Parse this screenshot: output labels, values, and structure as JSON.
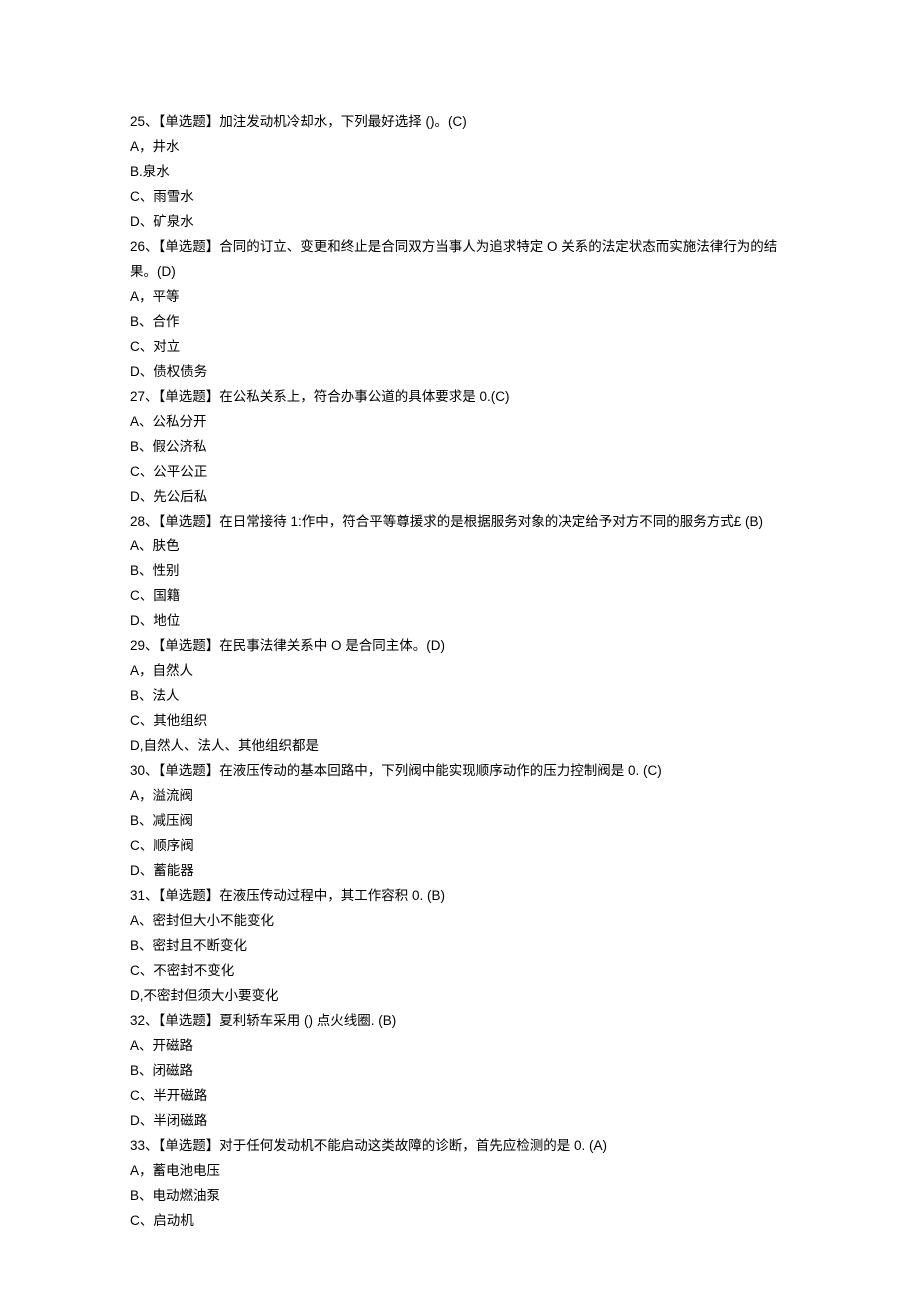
{
  "questions": [
    {
      "stem": "25、【单选题】加注发动机冷却水，下列最好选择 ()。(C)",
      "options": [
        "A，井水",
        "B.泉水",
        "C、雨雪水",
        "D、矿泉水"
      ]
    },
    {
      "stem": "26、【单选题】合同的订立、变更和终止是合同双方当事人为追求特定 O 关系的法定状态而实施法律行为的结果。(D)",
      "options": [
        "A，平等",
        "B、合作",
        "C、对立",
        "D、债权债务"
      ]
    },
    {
      "stem": "27、【单选题】在公私关系上，符合办事公道的具体要求是 0.(C)",
      "options": [
        "A、公私分开",
        "B、假公济私",
        "C、公平公正",
        "D、先公后私"
      ]
    },
    {
      "stem": "28、【单选题】在日常接待 1:作中，符合平等尊援求的是根据服务对象的决定给予对方不同的服务方式£ (B)",
      "options": [
        "A、肤色",
        "B、性别",
        "C、国籍",
        "D、地位"
      ]
    },
    {
      "stem": "29、【单选题】在民事法律关系中 O 是合同主体。(D)",
      "options": [
        "A，自然人",
        "B、法人",
        "C、其他组织",
        "D,自然人、法人、其他组织都是"
      ]
    },
    {
      "stem": "30、【单选题】在液压传动的基本回路中，下列阀中能实现顺序动作的压力控制阀是 0. (C)",
      "options": [
        "A，溢流阀",
        "B、减压阀",
        "C、顺序阀",
        "D、蓄能器"
      ]
    },
    {
      "stem": "31、【单选题】在液压传动过程中，其工作容积 0. (B)",
      "options": [
        "A、密封但大小不能变化",
        "B、密封且不断变化",
        "C、不密封不变化",
        "D,不密封但须大小要变化"
      ]
    },
    {
      "stem": "32、【单选题】夏利轿车采用 () 点火线圈. (B)",
      "options": [
        "A、开磁路",
        "B、闭磁路",
        "C、半开磁路",
        "D、半闭磁路"
      ]
    },
    {
      "stem": "33、【单选题】对于任何发动机不能启动这类故障的诊断，首先应检测的是 0. (A)",
      "options": [
        "A，蓄电池电压",
        "B、电动燃油泵",
        "C、启动机"
      ]
    }
  ]
}
